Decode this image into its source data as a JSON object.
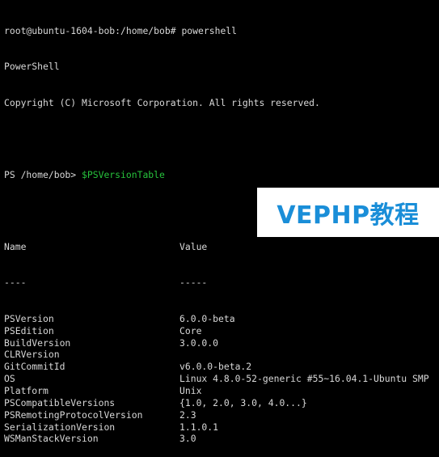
{
  "terminal": {
    "prompt_line": "root@ubuntu-1604-bob:/home/bob# powershell",
    "banner_line1": "PowerShell",
    "banner_line2": "Copyright (C) Microsoft Corporation. All rights reserved.",
    "ps_prompt": "PS /home/bob> ",
    "ps_command": "$PSVersionTable",
    "header": {
      "name": "Name",
      "value": "Value"
    },
    "header_rule": {
      "name": "----",
      "value": "-----"
    },
    "rows": [
      {
        "name": "PSVersion",
        "value": "6.0.0-beta"
      },
      {
        "name": "PSEdition",
        "value": "Core"
      },
      {
        "name": "BuildVersion",
        "value": "3.0.0.0"
      },
      {
        "name": "CLRVersion",
        "value": ""
      },
      {
        "name": "GitCommitId",
        "value": "v6.0.0-beta.2"
      },
      {
        "name": "OS",
        "value": "Linux 4.8.0-52-generic #55~16.04.1-Ubuntu SMP"
      },
      {
        "name": "Platform",
        "value": "Unix"
      },
      {
        "name": "PSCompatibleVersions",
        "value": "{1.0, 2.0, 3.0, 4.0...}"
      },
      {
        "name": "PSRemotingProtocolVersion",
        "value": "2.3"
      },
      {
        "name": "SerializationVersion",
        "value": "1.1.0.1"
      },
      {
        "name": "WSManStackVersion",
        "value": "3.0"
      }
    ]
  },
  "watermark": {
    "text": "VEPHP教程",
    "color": "#1a8ed8"
  },
  "colors": {
    "background": "#000000",
    "text": "#d8d8d8",
    "command": "#27c23c"
  }
}
